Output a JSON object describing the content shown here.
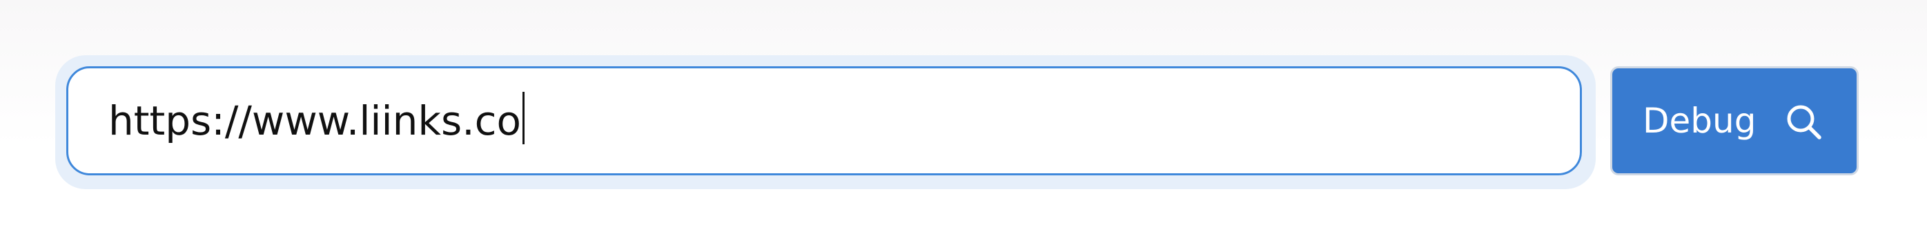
{
  "url_bar": {
    "value": "https://www.liinks.co",
    "accent_color": "#3f88db"
  },
  "debug_button": {
    "label": "Debug",
    "icon": "search-icon",
    "background_color": "#387bd0"
  }
}
